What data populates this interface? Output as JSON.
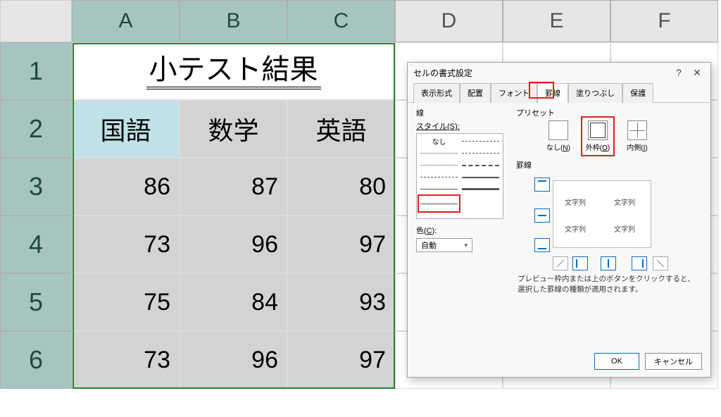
{
  "columns": [
    "A",
    "B",
    "C",
    "D",
    "E",
    "F"
  ],
  "rows": [
    "1",
    "2",
    "3",
    "4",
    "5",
    "6"
  ],
  "sheet": {
    "title": "小テスト結果",
    "headers": {
      "kokugo": "国語",
      "suugaku": "数学",
      "eigo": "英語"
    },
    "data": [
      {
        "a": "86",
        "b": "87",
        "c": "80"
      },
      {
        "a": "73",
        "b": "96",
        "c": "97"
      },
      {
        "a": "75",
        "b": "84",
        "c": "93"
      },
      {
        "a": "73",
        "b": "96",
        "c": "97"
      }
    ]
  },
  "dialog": {
    "title": "セルの書式設定",
    "tabs": {
      "display": "表示形式",
      "alignment": "配置",
      "font": "フォント",
      "border": "罫線",
      "fill": "塗りつぶし",
      "protection": "保護"
    },
    "line_group": "線",
    "style_label": "スタイル(S):",
    "style_none": "なし",
    "color_label": "色(C):",
    "color_value": "自動",
    "preset_group": "プリセット",
    "presets": {
      "none": "なし(",
      "none_mn": "N",
      "none2": ")",
      "outline": "外枠(",
      "outline_mn": "O",
      "outline2": ")",
      "inside": "内側(",
      "inside_mn": "I",
      "inside2": ")"
    },
    "border_group": "罫線",
    "preview_text": "文字列",
    "hint": "プレビュー枠内または上のボタンをクリックすると、選択した罫線の種類が適用されます。",
    "ok": "OK",
    "cancel": "キャンセル"
  },
  "chart_data": {
    "type": "table",
    "title": "小テスト結果",
    "columns": [
      "国語",
      "数学",
      "英語"
    ],
    "rows": [
      [
        86,
        87,
        80
      ],
      [
        73,
        96,
        97
      ],
      [
        75,
        84,
        93
      ],
      [
        73,
        96,
        97
      ]
    ]
  }
}
